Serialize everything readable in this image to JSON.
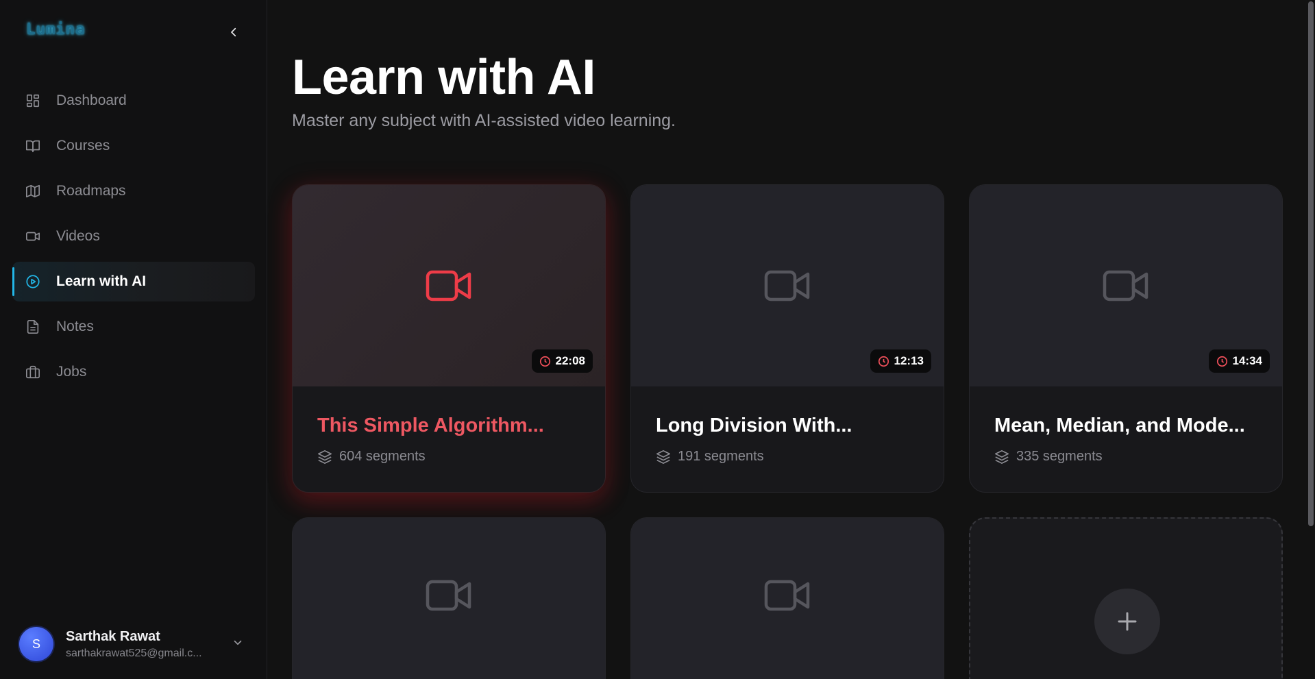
{
  "app": {
    "logo": "Lumina"
  },
  "sidebar": {
    "items": [
      {
        "label": "Dashboard",
        "icon": "dashboard-icon",
        "active": false
      },
      {
        "label": "Courses",
        "icon": "book-icon",
        "active": false
      },
      {
        "label": "Roadmaps",
        "icon": "map-icon",
        "active": false
      },
      {
        "label": "Videos",
        "icon": "video-icon",
        "active": false
      },
      {
        "label": "Learn with AI",
        "icon": "play-circle-icon",
        "active": true
      },
      {
        "label": "Notes",
        "icon": "file-text-icon",
        "active": false
      },
      {
        "label": "Jobs",
        "icon": "briefcase-icon",
        "active": false
      }
    ],
    "user": {
      "initial": "S",
      "name": "Sarthak Rawat",
      "email": "sarthakrawat525@gmail.c..."
    }
  },
  "main": {
    "title": "Learn with AI",
    "subtitle": "Master any subject with AI-assisted video learning.",
    "cards": [
      {
        "title": "This Simple Algorithm...",
        "duration": "22:08",
        "segments": "604 segments"
      },
      {
        "title": "Long Division With...",
        "duration": "12:13",
        "segments": "191 segments"
      },
      {
        "title": "Mean, Median, and Mode...",
        "duration": "14:34",
        "segments": "335 segments"
      }
    ]
  },
  "colors": {
    "accent": "#22b7e8",
    "highlight_red": "#ee5862",
    "background": "#121212"
  }
}
